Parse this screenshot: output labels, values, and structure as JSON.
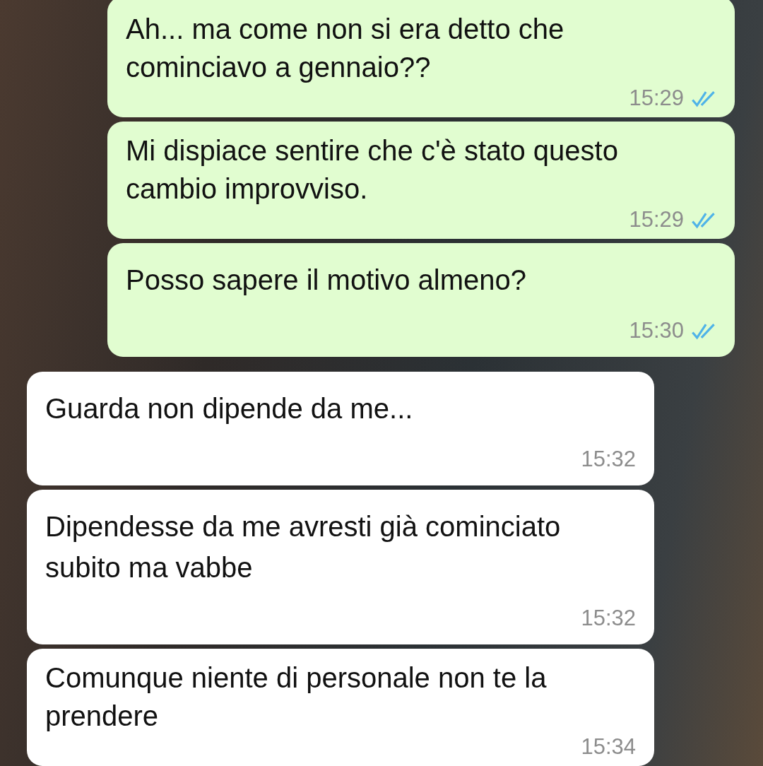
{
  "messages": [
    {
      "kind": "outgoing",
      "text": "Ah... ma come non si era detto che cominciavo a gennaio??",
      "time": "15:29",
      "read": true
    },
    {
      "kind": "outgoing",
      "text": "Mi dispiace sentire che c'è stato questo cambio improvviso.",
      "time": "15:29",
      "read": true
    },
    {
      "kind": "outgoing",
      "text": "Posso sapere il motivo almeno?",
      "time": "15:30",
      "read": true
    },
    {
      "kind": "incoming",
      "text": "Guarda non dipende da me...",
      "time": "15:32"
    },
    {
      "kind": "incoming",
      "text": "Dipendesse da me avresti già cominciato subito ma vabbe",
      "time": "15:32"
    },
    {
      "kind": "incoming",
      "text": "Comunque niente di personale non te la prendere",
      "time": "15:34"
    }
  ]
}
